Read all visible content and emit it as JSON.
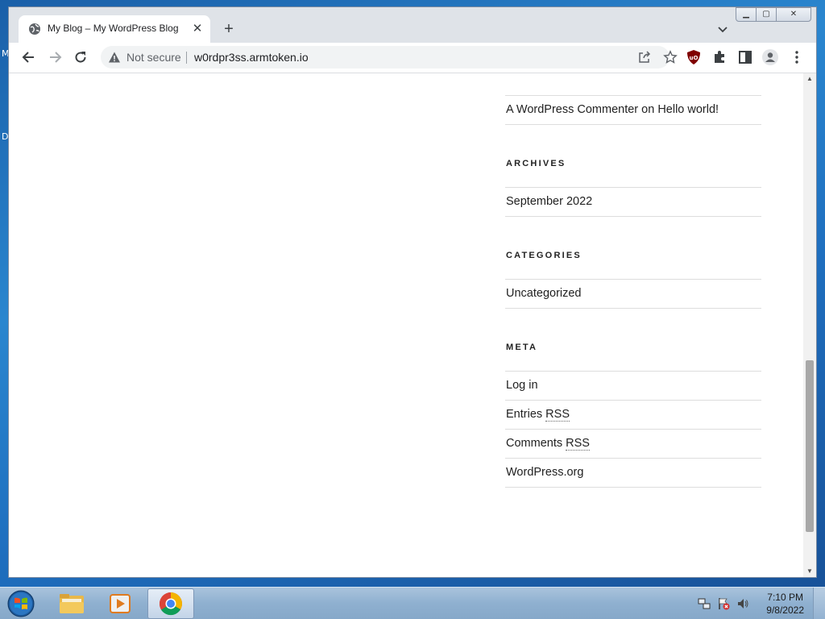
{
  "desktop": {
    "edge_letters": [
      "M",
      "D"
    ]
  },
  "browser": {
    "tab": {
      "title": "My Blog – My WordPress Blog",
      "close_glyph": "✕"
    },
    "new_tab_glyph": "+",
    "window_controls": {
      "minimize": "▁",
      "maximize": "▢",
      "close": "✕"
    },
    "toolbar": {
      "security_status": "Not secure",
      "url": "w0rdpr3ss.armtoken.io"
    },
    "extension_icons": [
      "ublock-origin-icon",
      "puzzle-extensions-icon",
      "side-panel-icon",
      "profile-icon",
      "kebab-menu-icon"
    ]
  },
  "page": {
    "recent_comments": [
      {
        "author": "A WordPress Commenter",
        "connector": "on",
        "post": "Hello world!"
      }
    ],
    "archives": {
      "title": "ARCHIVES",
      "items": [
        "September 2022"
      ]
    },
    "categories": {
      "title": "CATEGORIES",
      "items": [
        "Uncategorized"
      ]
    },
    "meta": {
      "title": "META",
      "log_in": "Log in",
      "entries_prefix": "Entries",
      "comments_prefix": "Comments",
      "rss": "RSS",
      "wordpress_org": "WordPress.org"
    }
  },
  "scrollbar": {
    "up_glyph": "▲",
    "down_glyph": "▼"
  },
  "taskbar": {
    "apps": [
      "windows-explorer",
      "media-player",
      "google-chrome"
    ],
    "clock": {
      "time": "7:10 PM",
      "date": "9/8/2022"
    }
  },
  "colors": {
    "chrome_frame": "#dfe3e8",
    "omnibox_bg": "#f1f3f4",
    "text": "#222222",
    "rule": "#dddddd",
    "ublock_red": "#800000"
  }
}
